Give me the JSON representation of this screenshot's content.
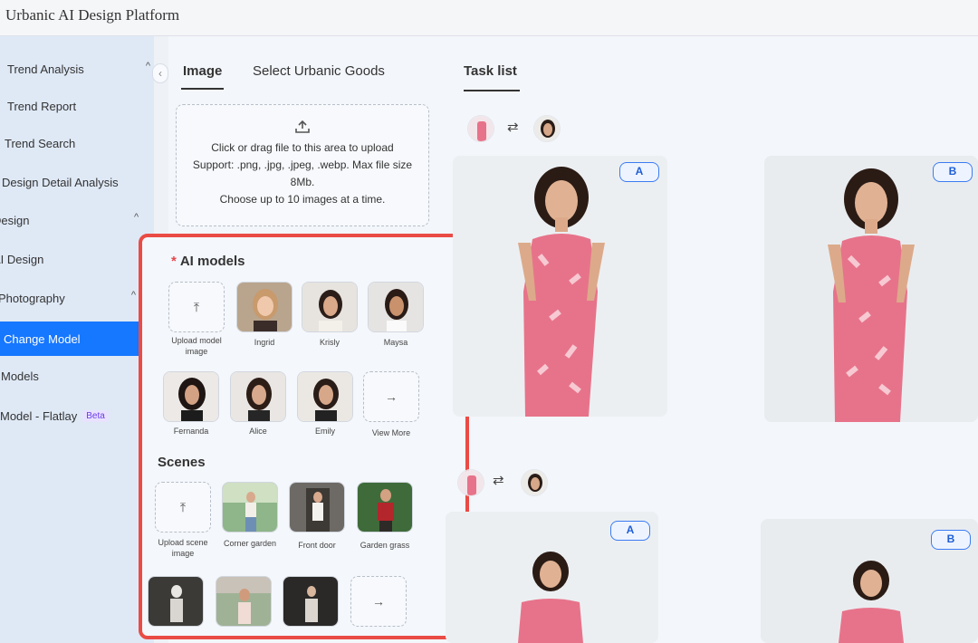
{
  "app": {
    "title": "Urbanic AI Design Platform"
  },
  "sidebar": {
    "collapse_icon": "chevron-left",
    "items": [
      {
        "label": "Trend Analysis",
        "chevron": "^"
      },
      {
        "label": "Trend Report"
      },
      {
        "label": "Trend Search"
      },
      {
        "label": "Design Detail Analysis"
      },
      {
        "label": "Design",
        "chevron": "^"
      },
      {
        "label": "AI Design"
      },
      {
        "label": "Photography",
        "chevron": "^"
      },
      {
        "label": "Change Model",
        "active": true
      },
      {
        "label": "Models"
      },
      {
        "label": "Model - Flatlay",
        "badge": "Beta"
      }
    ]
  },
  "tabs": {
    "image": "Image",
    "goods": "Select Urbanic Goods",
    "task": "Task list"
  },
  "upload": {
    "icon": "upload-icon",
    "line1": "Click or drag file to this area to upload",
    "line2": "Support: .png, .jpg, .jpeg, .webp. Max file size 8Mb.",
    "line3": "Choose up to 10 images at a time."
  },
  "ai_models": {
    "required_mark": "*",
    "title": "AI models",
    "upload_label": "Upload model image",
    "names": [
      "Ingrid",
      "Krisly",
      "Maysa",
      "Fernanda",
      "Alice",
      "Emily"
    ],
    "view_more": "View More"
  },
  "scenes": {
    "title": "Scenes",
    "upload_label": "Upload scene image",
    "names": [
      "Corner garden",
      "Front door",
      "Garden grass"
    ]
  },
  "results": {
    "badge_a": "A",
    "badge_b": "B"
  },
  "colors": {
    "accent": "#1677ff",
    "highlight": "#ea4b45",
    "dress": "#e7738a"
  }
}
